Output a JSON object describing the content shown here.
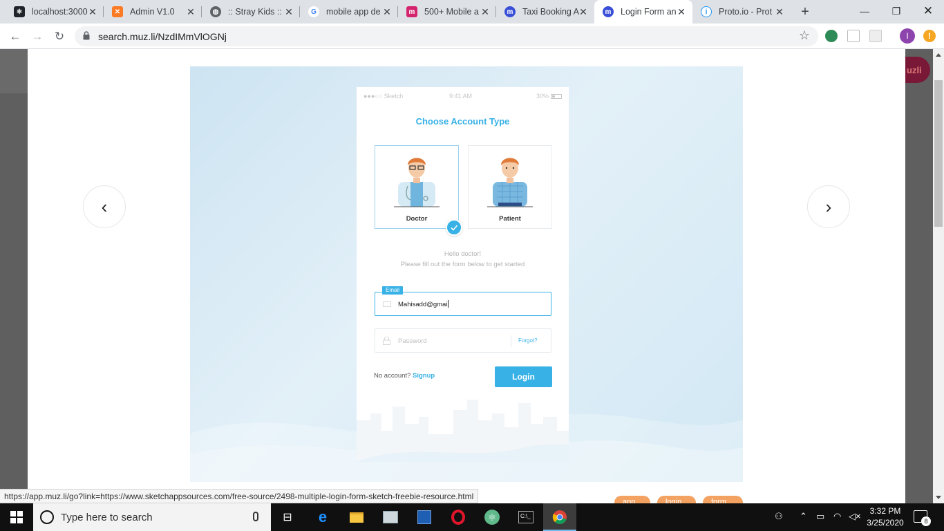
{
  "browser": {
    "tabs": [
      {
        "title": "localhost:3000",
        "favicon": "react-icon",
        "color": "#20232a"
      },
      {
        "title": "Admin V1.0",
        "favicon": "xampp-icon",
        "color": "#fb7a24"
      },
      {
        "title": ":: Stray Kids ::",
        "favicon": "globe-icon",
        "color": "#5f6368"
      },
      {
        "title": "mobile app de",
        "favicon": "google-icon",
        "color": "#ffffff"
      },
      {
        "title": "500+ Mobile a",
        "favicon": "m-icon",
        "color": "#d5246e"
      },
      {
        "title": "Taxi Booking A",
        "favicon": "muzli-icon",
        "color": "#3a4fd8"
      },
      {
        "title": "Login Form an",
        "favicon": "muzli-icon",
        "color": "#3a4fd8",
        "active": true
      },
      {
        "title": "Proto.io - Prot",
        "favicon": "info-icon",
        "color": "#2196f3"
      }
    ],
    "url": "search.muz.li/NzdIMmVlOGNj",
    "profile_initial": "I"
  },
  "page": {
    "muzli_label": "uzli",
    "prev_label": "‹",
    "next_label": "›",
    "tags": [
      "app",
      "login",
      "form"
    ],
    "status_url": "https://app.muz.li/go?link=https://www.sketchappsources.com/free-source/2498-multiple-login-form-sketch-freebie-resource.html"
  },
  "mockup": {
    "status": {
      "carrier": "●●●○○ Sketch",
      "time": "9:41 AM",
      "battery": "30%"
    },
    "title": "Choose Account Type",
    "accounts": [
      {
        "label": "Doctor",
        "selected": true
      },
      {
        "label": "Patient",
        "selected": false
      }
    ],
    "greeting": "Hello doctor!",
    "instruction": "Please fill out the form below to get started",
    "email_label": "Email",
    "email_value": "Mahisadd@gmai",
    "password_placeholder": "Password",
    "forgot_label": "Forgot?",
    "no_account_text": "No account?",
    "signup_label": "Signup",
    "login_label": "Login",
    "accent_color": "#37b1e6"
  },
  "taskbar": {
    "search_placeholder": "Type here to search",
    "time": "3:32 PM",
    "date": "3/25/2020",
    "notification_count": "8"
  }
}
